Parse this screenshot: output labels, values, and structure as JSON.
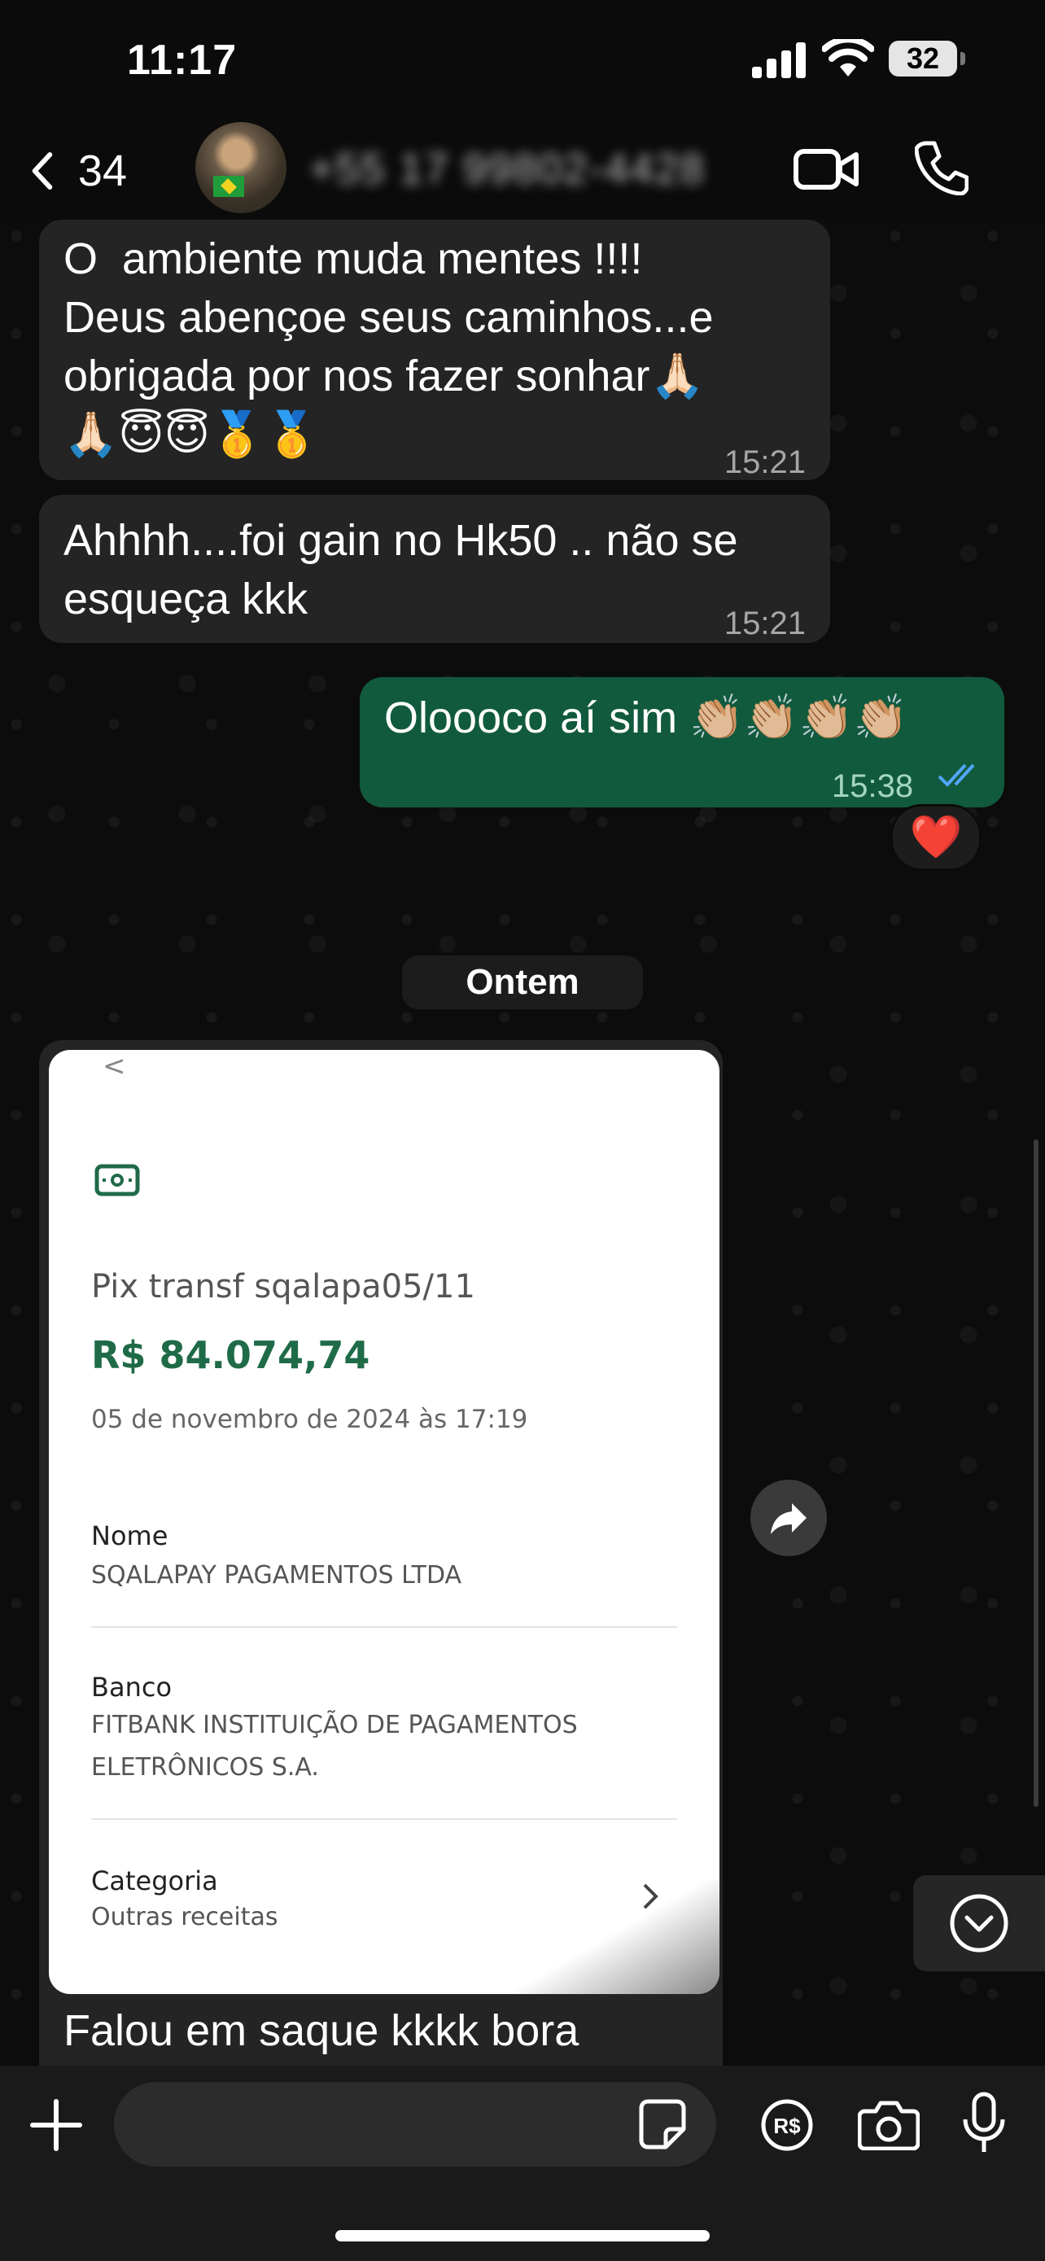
{
  "status_bar": {
    "time": "11:17",
    "battery": "32"
  },
  "header": {
    "back_count": "34",
    "contact_name": "+55 17 99802-4428"
  },
  "messages": [
    {
      "direction": "in",
      "text": "O  ambiente muda mentes !!!!\nDeus abençoe seus caminhos...e\nobrigada por nos fazer sonhar🙏🏻\n🙏🏻😇😇🥇🥇",
      "time": "15:21"
    },
    {
      "direction": "in",
      "text": "Ahhhh....foi gain no Hk50 .. não se\nesqueça kkk",
      "time": "15:21"
    },
    {
      "direction": "out",
      "text": "Oloooco aí sim 👏🏼👏🏼👏🏼👏🏼",
      "time": "15:38",
      "reaction": "❤️"
    }
  ],
  "day_divider": "Ontem",
  "receipt": {
    "back_glyph": "<",
    "title": "Pix transf  sqalapa05/11",
    "amount": "R$ 84.074,74",
    "date": "05 de novembro de 2024 às 17:19",
    "rows": [
      {
        "label": "Nome",
        "value": "SQALAPAY PAGAMENTOS LTDA"
      },
      {
        "label": "Banco",
        "value": "FITBANK INSTITUIÇÃO DE PAGAMENTOS\nELETRÔNICOS S.A."
      },
      {
        "label": "Categoria",
        "value": "Outras receitas"
      }
    ]
  },
  "caption": "Falou em saque kkkk bora",
  "composer": {
    "placeholder": ""
  },
  "colors": {
    "outgoing_bubble": "#115a3e",
    "incoming_bubble": "#242424",
    "amount_green": "#1f6b48",
    "read_check": "#53a6fd"
  },
  "icons": [
    "back-chevron-icon",
    "video-call-icon",
    "phone-icon",
    "money-icon",
    "forward-icon",
    "scroll-down-icon",
    "plus-icon",
    "sticker-icon",
    "pay-icon",
    "camera-icon",
    "microphone-icon"
  ]
}
